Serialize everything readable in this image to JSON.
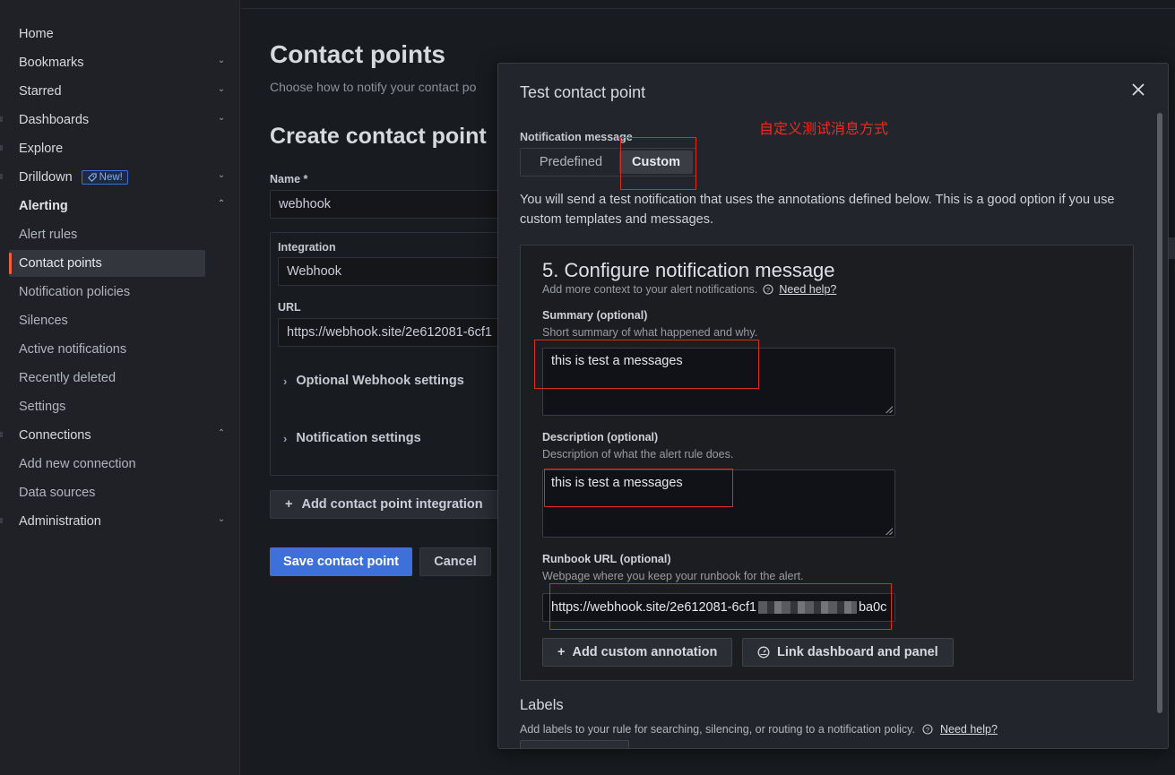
{
  "sidebar": {
    "items": [
      {
        "label": "Home",
        "chevron": false
      },
      {
        "label": "Bookmarks",
        "chevron": "down"
      },
      {
        "label": "Starred",
        "chevron": "down"
      },
      {
        "label": "Dashboards",
        "chevron": "down"
      },
      {
        "label": "Explore",
        "chevron": false
      },
      {
        "label": "Drilldown",
        "chevron": "down",
        "badge": "New!"
      },
      {
        "label": "Alerting",
        "chevron": "up"
      },
      {
        "label": "Alert rules"
      },
      {
        "label": "Contact points",
        "active": true
      },
      {
        "label": "Notification policies"
      },
      {
        "label": "Silences"
      },
      {
        "label": "Active notifications"
      },
      {
        "label": "Recently deleted"
      },
      {
        "label": "Settings"
      },
      {
        "label": "Connections",
        "chevron": "up"
      },
      {
        "label": "Add new connection"
      },
      {
        "label": "Data sources"
      },
      {
        "label": "Administration",
        "chevron": "down"
      }
    ]
  },
  "page": {
    "title": "Contact points",
    "subtitle": "Choose how to notify your contact po",
    "section_title": "Create contact point",
    "name_label": "Name *",
    "name_value": "webhook",
    "integration_label": "Integration",
    "integration_value": "Webhook",
    "url_label": "URL",
    "url_value": "https://webhook.site/2e612081-6cf1",
    "optional_webhook": "Optional Webhook settings",
    "notification_settings": "Notification settings",
    "add_integration": "Add contact point integration",
    "save": "Save contact point",
    "cancel": "Cancel"
  },
  "modal": {
    "title": "Test contact point",
    "notification_message_label": "Notification message",
    "options": [
      "Predefined",
      "Custom"
    ],
    "selected": "Custom",
    "intro": "You will send a test notification that uses the annotations defined below. This is a good option if you use custom templates and messages.",
    "card": {
      "title": "5. Configure notification message",
      "subtitle": "Add more context to your alert notifications.",
      "help": "Need help?",
      "summary_label": "Summary (optional)",
      "summary_desc": "Short summary of what happened and why.",
      "summary_value": "this is test a messages",
      "description_label": "Description (optional)",
      "description_desc": "Description of what the alert rule does.",
      "description_value": "this is test a messages",
      "runbook_label": "Runbook URL (optional)",
      "runbook_desc": "Webpage where you keep your runbook for the alert.",
      "runbook_value_start": "https://webhook.site/2e612081-6cf1",
      "runbook_value_end": "ba0c",
      "add_annotation": "Add custom annotation",
      "link_dashboard": "Link dashboard and panel"
    },
    "labels_title": "Labels",
    "labels_sub": "Add labels to your rule for searching, silencing, or routing to a notification policy.",
    "labels_help": "Need help?"
  },
  "annotation_text": "自定义测试消息方式",
  "colors": {
    "accent": "#3d71d9",
    "active_indicator": "#f55f3e",
    "annotation_red": "#e02a1e"
  }
}
